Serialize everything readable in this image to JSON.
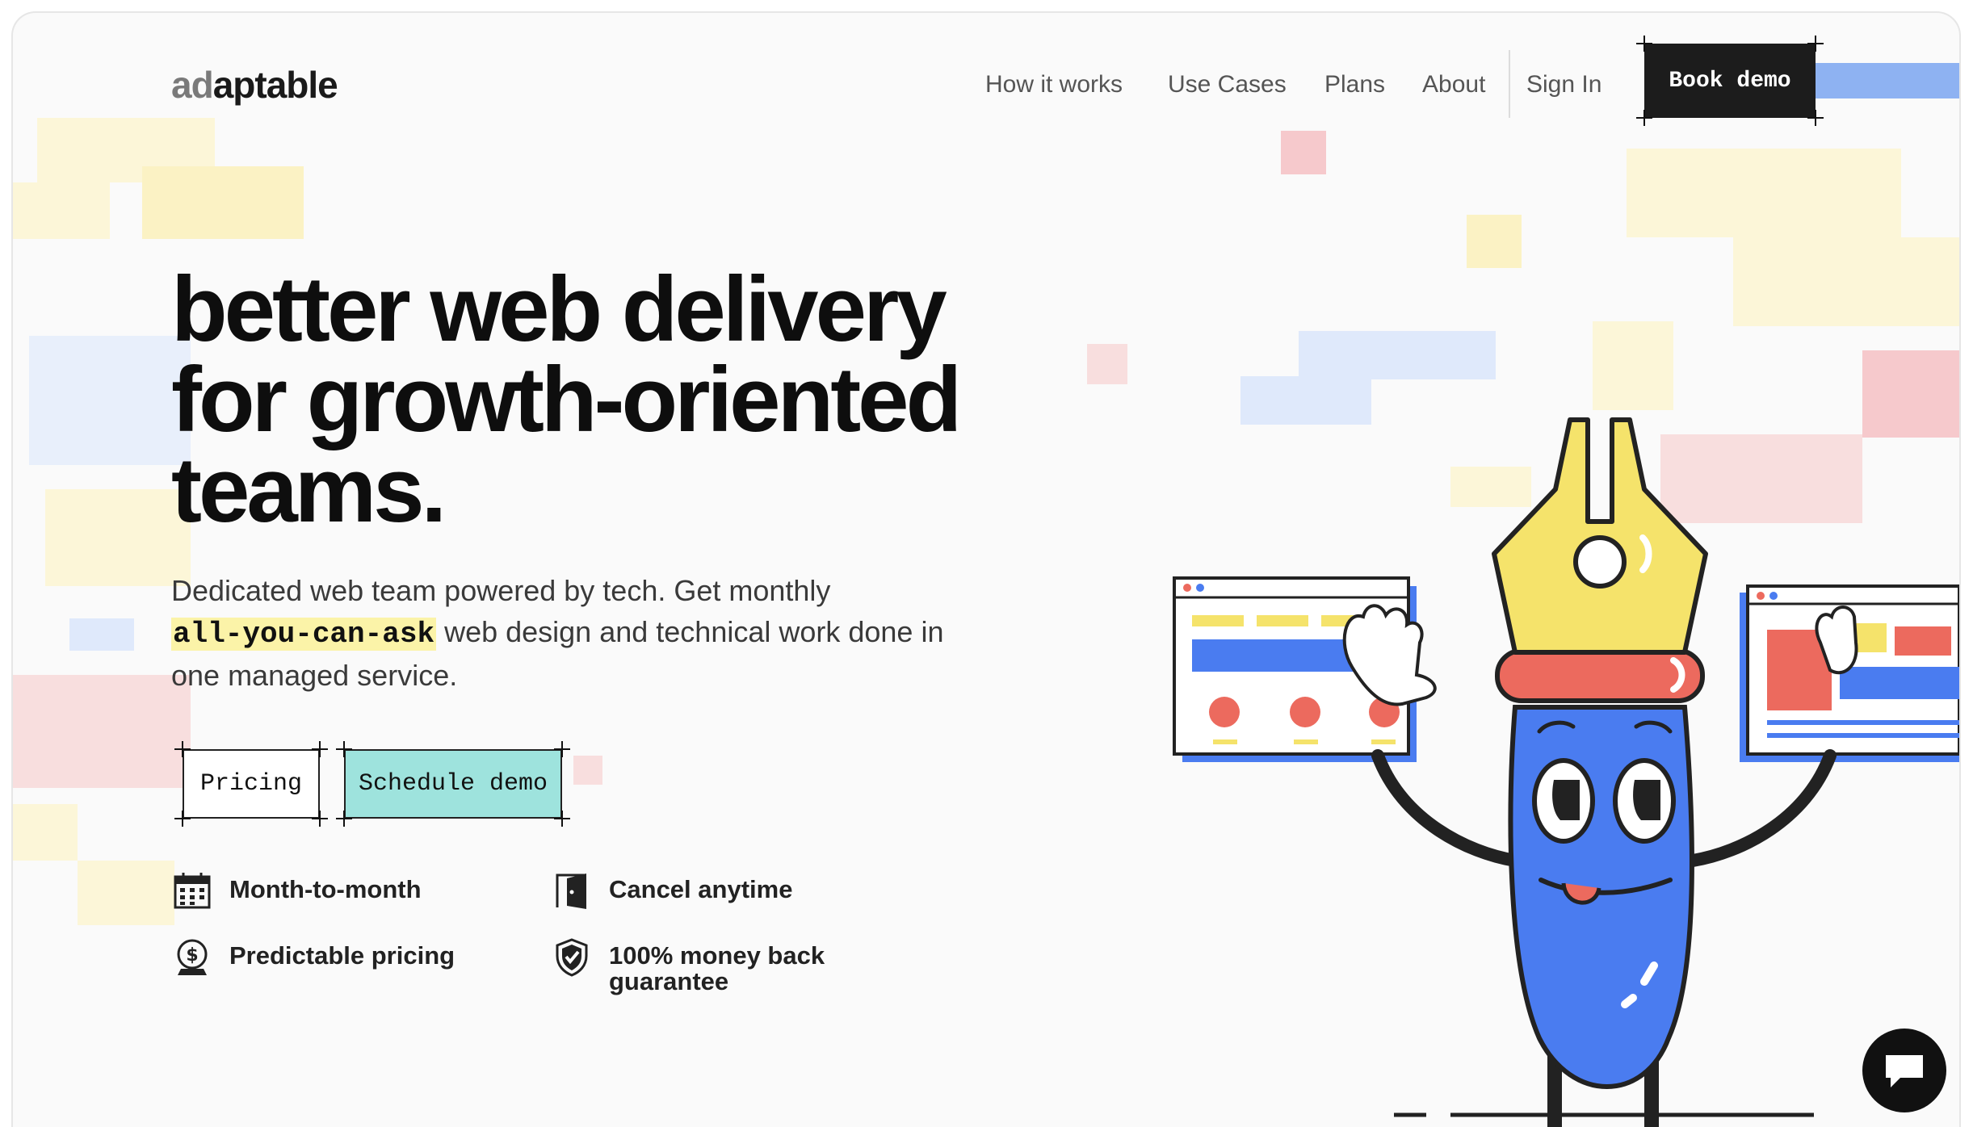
{
  "brand": {
    "logo_light": "ad",
    "logo_rest": "aptable"
  },
  "nav": {
    "items": [
      "How it works",
      "Use Cases",
      "Plans",
      "About"
    ],
    "sign_in": "Sign In",
    "book_demo": "Book demo"
  },
  "hero": {
    "title_line1": "better web delivery",
    "title_line2": "for growth-oriented",
    "title_line3": "teams.",
    "sub_before": "Dedicated web team powered by tech. Get monthly",
    "sub_highlight": "all-you-can-ask",
    "sub_after": "web design and technical work done in one managed service."
  },
  "buttons": {
    "pricing": "Pricing",
    "schedule_demo": "Schedule demo"
  },
  "features": {
    "month": "Month-to-month",
    "cancel": "Cancel anytime",
    "pricing": "Predictable pricing",
    "guarantee_line1": "100% money back",
    "guarantee_line2": "guarantee"
  },
  "icons": {
    "features": [
      "calendar-icon",
      "door-icon",
      "money-icon",
      "shield-check-icon"
    ],
    "chat": "chat-icon"
  },
  "colors": {
    "demo_button": "#9ee3dd",
    "highlight": "#fbf3a8",
    "mascot_blue": "#4a7cf0",
    "mascot_yellow": "#f5e36b",
    "mascot_red": "#ec6a5e"
  }
}
